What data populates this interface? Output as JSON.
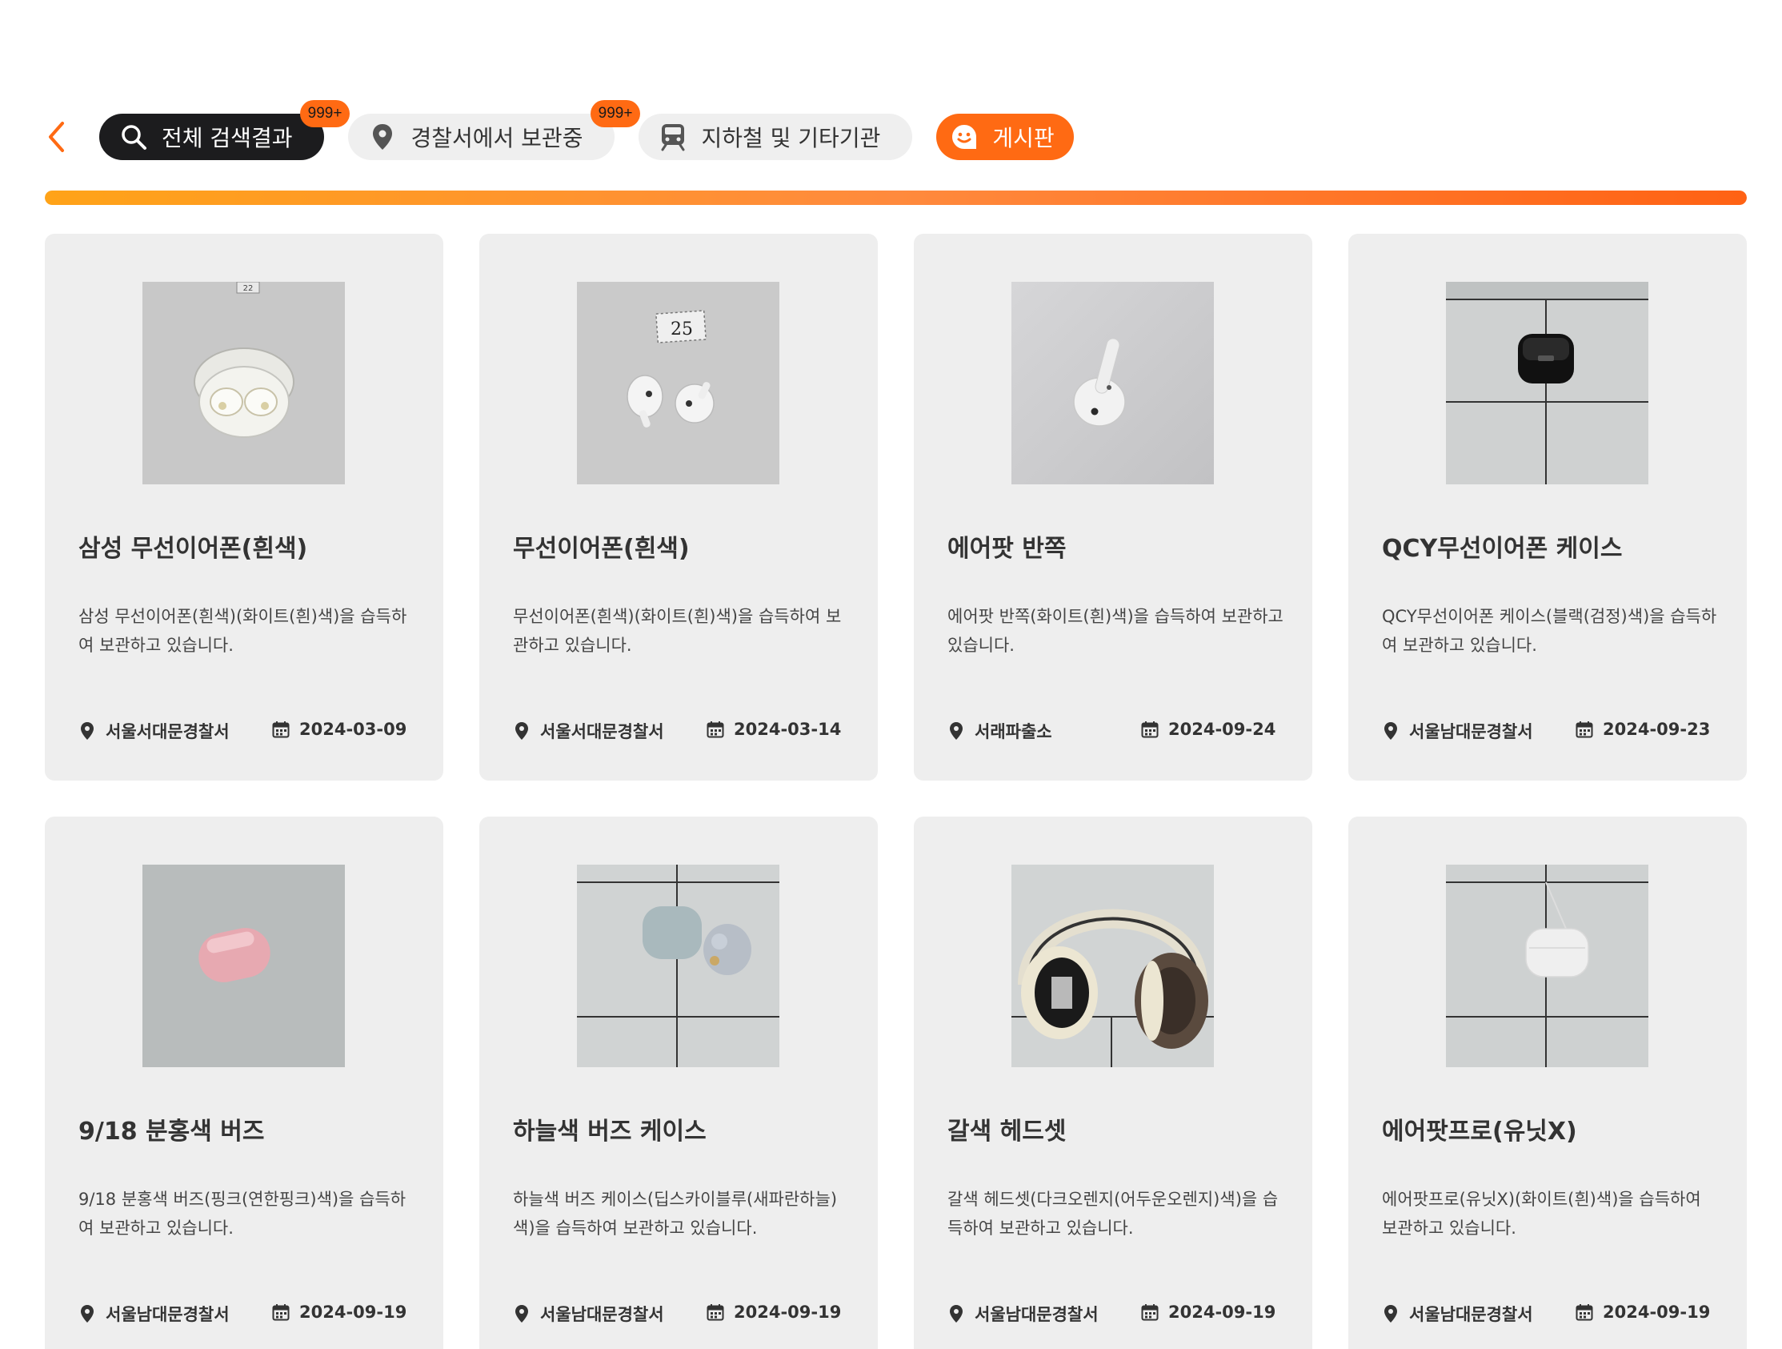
{
  "nav": {
    "tabs": [
      {
        "label": "전체 검색결과",
        "badge": "999+",
        "icon": "search-icon",
        "active": true
      },
      {
        "label": "경찰서에서 보관중",
        "badge": "999+",
        "icon": "location-pin-icon",
        "active": false
      },
      {
        "label": "지하철 및 기타기관",
        "badge": "",
        "icon": "subway-icon",
        "active": false
      },
      {
        "label": "게시판",
        "badge": "",
        "icon": "board-chat-icon",
        "active": false
      }
    ]
  },
  "colors": {
    "accent": "#ff6a13",
    "active_tab": "#1c1c1e",
    "card_bg": "#eeeeee"
  },
  "items": [
    {
      "title": "삼성 무선이어폰(흰색)",
      "desc": "삼성 무선이어폰(흰색)(화이트(흰)색)을 습득하여 보관하고 있습니다.",
      "place": "서울서대문경찰서",
      "date": "2024-03-09",
      "photo": "white-earbuds-open-case"
    },
    {
      "title": "무선이어폰(흰색)",
      "desc": "무선이어폰(흰색)(화이트(흰)색)을 습득하여 보관하고 있습니다.",
      "place": "서울서대문경찰서",
      "date": "2024-03-14",
      "photo": "two-white-earbuds-tag-25"
    },
    {
      "title": "에어팟 반쪽",
      "desc": "에어팟 반쪽(화이트(흰)색)을 습득하여 보관하고 있습니다.",
      "place": "서래파출소",
      "date": "2024-09-24",
      "photo": "single-airpod"
    },
    {
      "title": "QCY무선이어폰 케이스",
      "desc": "QCY무선이어폰 케이스(블랙(검정)색)을 습득하여 보관하고 있습니다.",
      "place": "서울남대문경찰서",
      "date": "2024-09-23",
      "photo": "black-earbud-case"
    },
    {
      "title": "9/18 분홍색 버즈",
      "desc": "9/18 분홍색 버즈(핑크(연한핑크)색)을 습득하여 보관하고 있습니다.",
      "place": "서울남대문경찰서",
      "date": "2024-09-19",
      "photo": "pink-buds-case"
    },
    {
      "title": "하늘색 버즈 케이스",
      "desc": "하늘색 버즈 케이스(딥스카이블루(새파란하늘)색)을 습득하여 보관하고 있습니다.",
      "place": "서울남대문경찰서",
      "date": "2024-09-19",
      "photo": "sky-blue-buds-case"
    },
    {
      "title": "갈색 헤드셋",
      "desc": "갈색 헤드셋(다크오렌지(어두운오렌지)색)을 습득하여 보관하고 있습니다.",
      "place": "서울남대문경찰서",
      "date": "2024-09-19",
      "photo": "brown-headset"
    },
    {
      "title": "에어팟프로(유닛X)",
      "desc": "에어팟프로(유닛X)(화이트(흰)색)을 습득하여 보관하고 있습니다.",
      "place": "서울남대문경찰서",
      "date": "2024-09-19",
      "photo": "airpods-pro-case"
    }
  ]
}
